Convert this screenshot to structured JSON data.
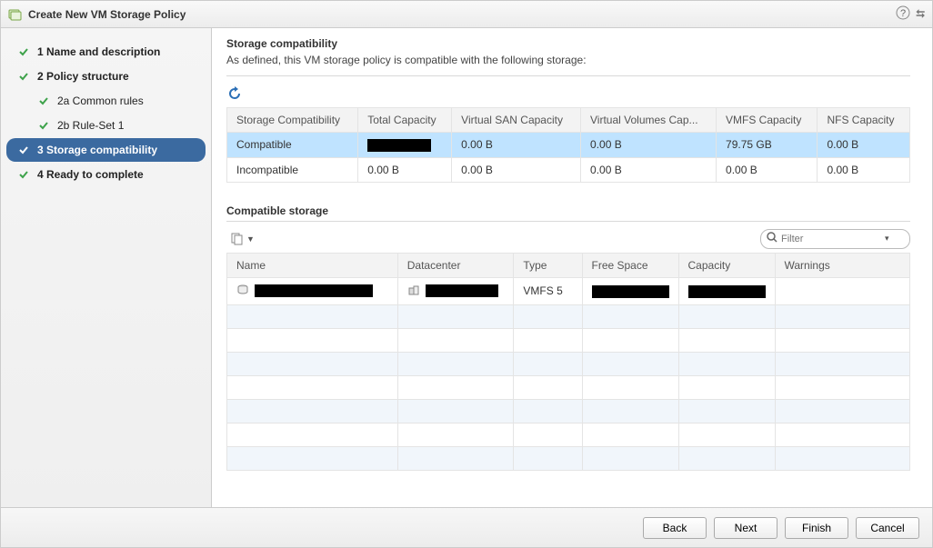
{
  "window": {
    "title": "Create New VM Storage Policy"
  },
  "steps": {
    "s1": "1  Name and description",
    "s2": "2  Policy structure",
    "s2a": "2a  Common rules",
    "s2b": "2b  Rule-Set 1",
    "s3": "3  Storage compatibility",
    "s4": "4  Ready to complete"
  },
  "content": {
    "heading": "Storage compatibility",
    "desc": "As defined, this VM storage policy is compatible with the following storage:"
  },
  "compat_table": {
    "headers": {
      "c0": "Storage Compatibility",
      "c1": "Total Capacity",
      "c2": "Virtual SAN Capacity",
      "c3": "Virtual Volumes Cap...",
      "c4": "VMFS Capacity",
      "c5": "NFS Capacity"
    },
    "rows": [
      {
        "label": "Compatible",
        "total": "",
        "vsan": "0.00 B",
        "vvol": "0.00 B",
        "vmfs": "79.75 GB",
        "nfs": "0.00 B"
      },
      {
        "label": "Incompatible",
        "total": "0.00 B",
        "vsan": "0.00 B",
        "vvol": "0.00 B",
        "vmfs": "0.00 B",
        "nfs": "0.00 B"
      }
    ]
  },
  "compatible_section": {
    "title": "Compatible storage"
  },
  "filter": {
    "placeholder": "Filter"
  },
  "storage_table": {
    "headers": {
      "name": "Name",
      "dc": "Datacenter",
      "type": "Type",
      "free": "Free Space",
      "cap": "Capacity",
      "warn": "Warnings"
    },
    "rows": [
      {
        "name": "",
        "dc": "",
        "type": "VMFS 5",
        "free": "",
        "cap": "",
        "warn": ""
      }
    ]
  },
  "footer": {
    "back": "Back",
    "next": "Next",
    "finish": "Finish",
    "cancel": "Cancel"
  }
}
